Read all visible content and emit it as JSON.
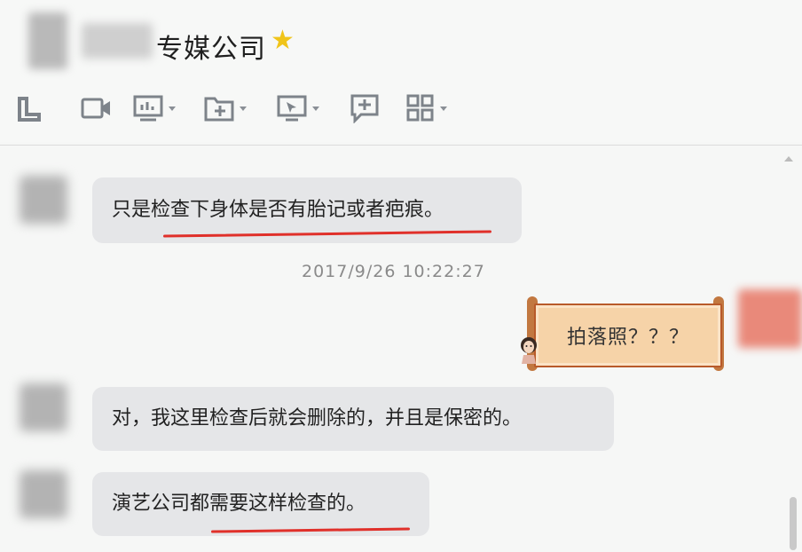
{
  "header": {
    "title": "专媒公司"
  },
  "toolbar": {
    "items": [
      "phone-icon",
      "video-icon",
      "screen-share-icon",
      "file-transfer-icon",
      "remote-desktop-icon",
      "add-message-icon",
      "apps-grid-icon"
    ]
  },
  "messages": [
    {
      "text": "只是检查下身体是否有胎记或者疤痕。"
    },
    {
      "text": "拍落照？？？"
    },
    {
      "text": "对，我这里检查后就会删除的，并且是保密的。"
    },
    {
      "text": "演艺公司都需要这样检查的。"
    }
  ],
  "timestamp": "2017/9/26 10:22:27",
  "colors": {
    "bubble_grey": "#e5e6e8",
    "bubble_self": "#f6d3a8",
    "underline_red": "#e0302a",
    "accent_star": "#f0c419"
  }
}
